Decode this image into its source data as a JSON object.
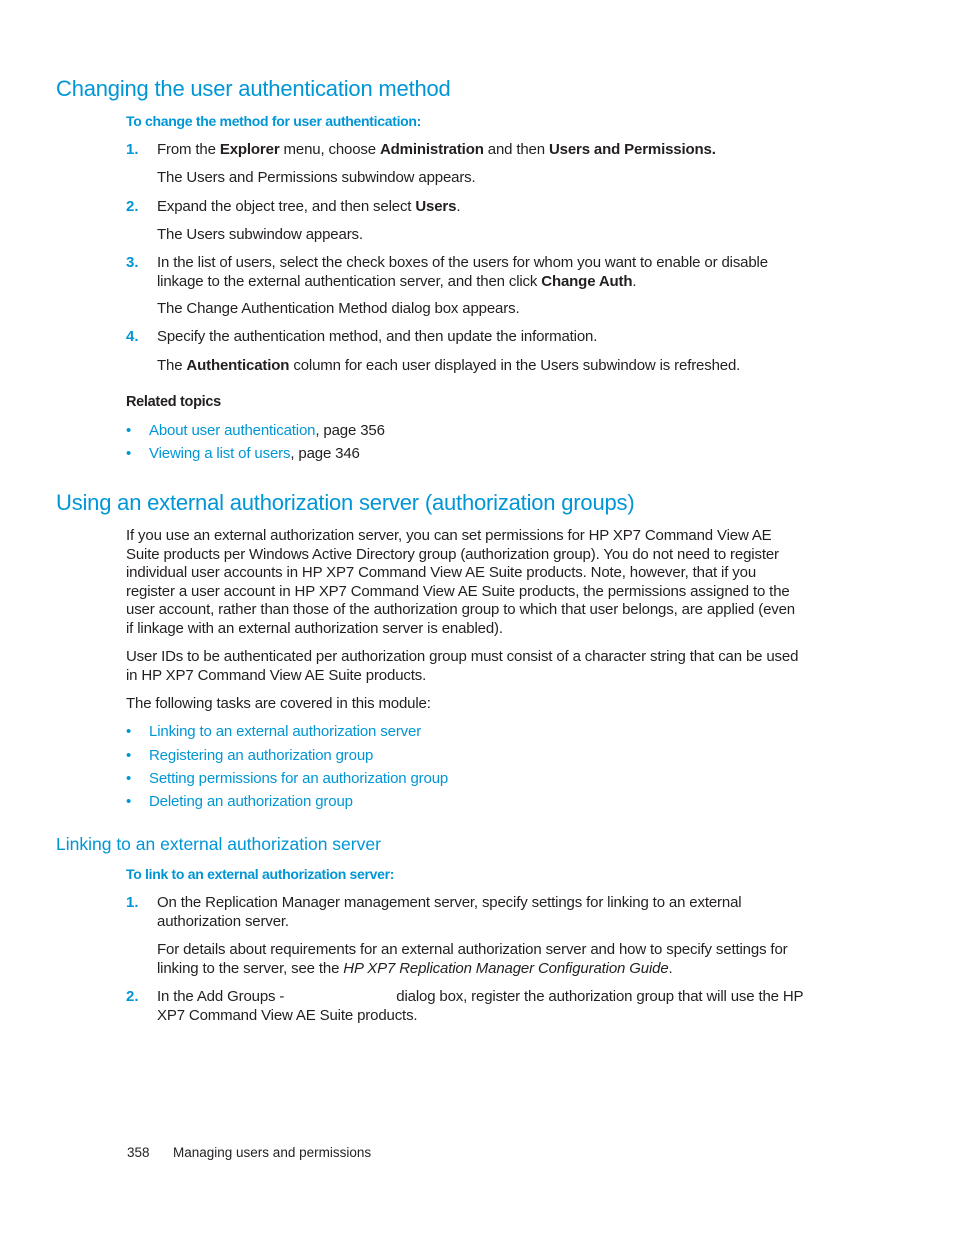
{
  "section1": {
    "title": "Changing the user authentication method",
    "procedure_title": "To change the method for user authentication:",
    "steps": [
      {
        "num": "1.",
        "parts": [
          "From the ",
          "Explorer",
          " menu, choose ",
          "Administration",
          " and then ",
          "Users and Permissions."
        ],
        "note": "The Users and Permissions subwindow appears."
      },
      {
        "num": "2.",
        "parts": [
          "Expand the object tree, and then select ",
          "Users",
          "."
        ],
        "note": "The Users subwindow appears."
      },
      {
        "num": "3.",
        "parts": [
          "In the list of users, select the check boxes of the users for whom you want to enable or disable linkage to the external authentication server, and then click ",
          "Change Auth",
          "."
        ],
        "note": "The Change Authentication Method dialog box appears."
      },
      {
        "num": "4.",
        "parts": [
          "Specify the authentication method, and then update the information."
        ],
        "note_parts": [
          "The ",
          "Authentication",
          " column for each user displayed in the Users subwindow is refreshed."
        ]
      }
    ],
    "related_title": "Related topics",
    "related": [
      {
        "link": "About user authentication",
        "suffix": ", page 356"
      },
      {
        "link": "Viewing a list of users",
        "suffix": ", page 346"
      }
    ]
  },
  "section2": {
    "title": "Using an external authorization server (authorization groups)",
    "para1": "If you use an external authorization server, you can set permissions for HP XP7 Command View AE Suite products per Windows Active Directory group (authorization group). You do not need to register individual user accounts in HP XP7 Command View AE Suite products. Note, however, that if you register a user account in HP XP7 Command View AE Suite products, the permissions assigned to the user account, rather than those of the authorization group to which that user belongs, are applied (even if linkage with an external authorization server is enabled).",
    "para2": "User IDs to be authenticated per authorization group must consist of a character string that can be used in HP XP7 Command View AE Suite products.",
    "para3": "The following tasks are covered in this module:",
    "tasks": [
      "Linking to an external authorization server",
      "Registering an authorization group",
      "Setting permissions for an authorization group",
      "Deleting an authorization group"
    ]
  },
  "section3": {
    "title": "Linking to an external authorization server",
    "procedure_title": "To link to an external authorization server:",
    "steps": [
      {
        "num": "1.",
        "text": "On the Replication Manager management server, specify settings for linking to an external authorization server.",
        "note_prefix": "For details about requirements for an external authorization server and how to specify settings for linking to the server, see the ",
        "note_italic": "HP XP7 Replication Manager Configuration Guide",
        "note_suffix": "."
      },
      {
        "num": "2.",
        "text_a": "In the Add Groups - ",
        "text_b": "dialog box, register the authorization group that will use the HP XP7 Command View AE Suite products."
      }
    ]
  },
  "footer": {
    "page_number": "358",
    "chapter": "Managing users and permissions"
  },
  "colors": {
    "accent": "#0096d6",
    "text": "#231f20"
  }
}
